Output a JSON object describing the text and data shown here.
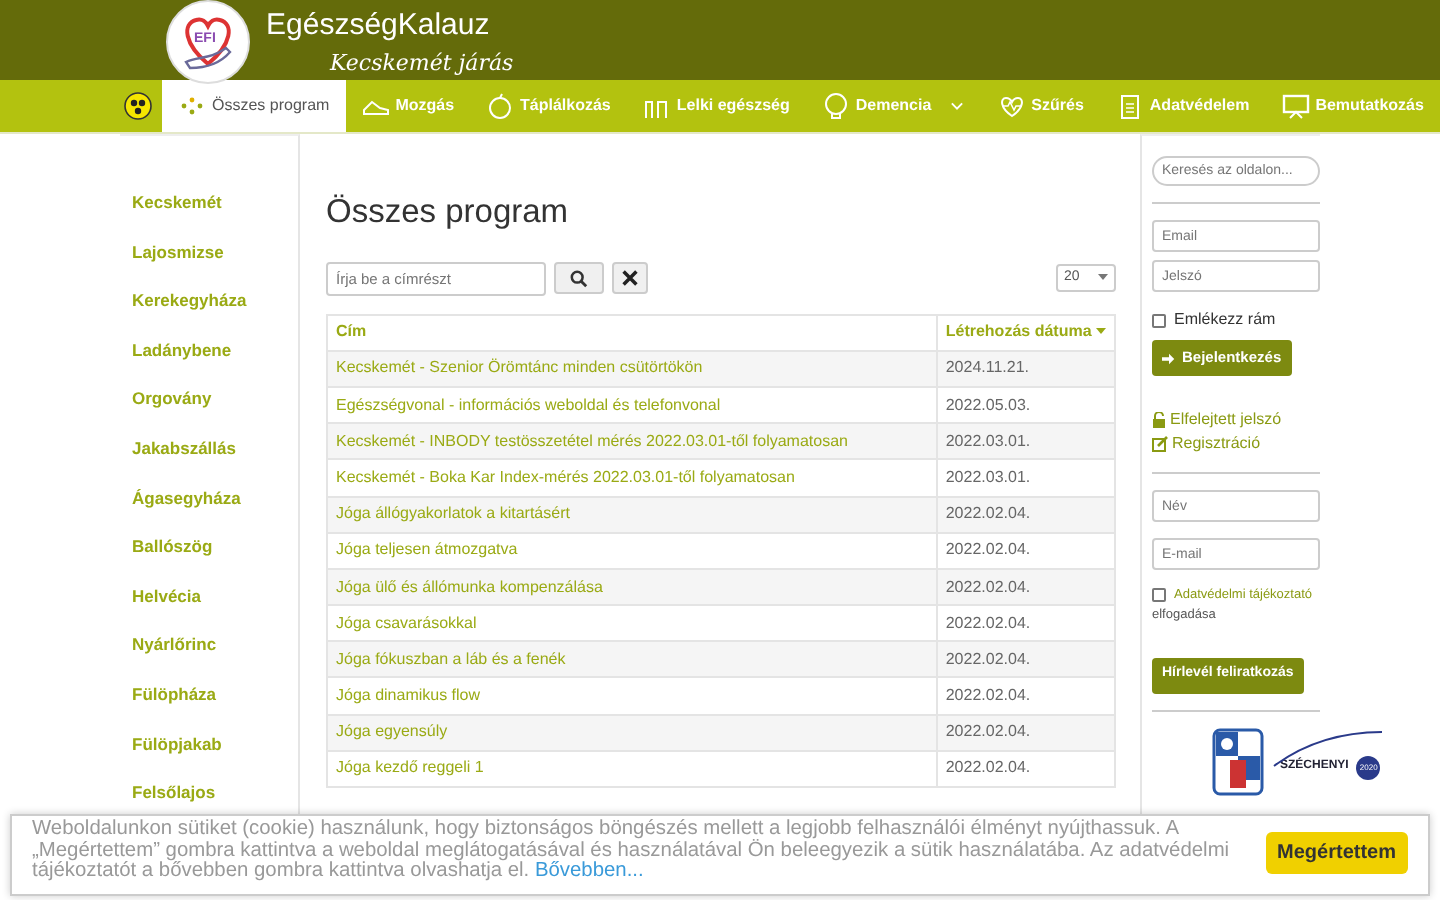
{
  "header": {
    "title": "EgészségKalauz",
    "subtitle": "Kecskemét járás",
    "logo_text": "EFI"
  },
  "nav": [
    {
      "label": "Összes program",
      "selected": true,
      "dropdown": false
    },
    {
      "label": "Mozgás",
      "selected": false,
      "dropdown": false
    },
    {
      "label": "Táplálkozás",
      "selected": false,
      "dropdown": false
    },
    {
      "label": "Lelki egészség",
      "selected": false,
      "dropdown": false
    },
    {
      "label": "Demencia",
      "selected": false,
      "dropdown": true
    },
    {
      "label": "Szűrés",
      "selected": false,
      "dropdown": false
    },
    {
      "label": "Adatvédelem",
      "selected": false,
      "dropdown": false
    },
    {
      "label": "Bemutatkozás",
      "selected": false,
      "dropdown": false
    }
  ],
  "sidebar": {
    "items": [
      "Kecskemét",
      "Lajosmizse",
      "Kerekegyháza",
      "Ladánybene",
      "Orgovány",
      "Jakabszállás",
      "Ágasegyháza",
      "Ballószög",
      "Helvécia",
      "Nyárlőrinc",
      "Fülöpháza",
      "Fülöpjakab",
      "Felsőlajos"
    ]
  },
  "main": {
    "heading": "Összes program",
    "filter": {
      "placeholder": "Írja be a címrészt"
    },
    "page_size": "20",
    "table": {
      "columns": [
        "Cím",
        "Létrehozás dátuma"
      ],
      "rows": [
        [
          "Kecskemét - Szenior Örömtánc minden csütörtökön",
          "2024.11.21."
        ],
        [
          "Egészségvonal - információs weboldal és telefonvonal",
          "2022.05.03."
        ],
        [
          "Kecskemét - INBODY testösszetétel mérés 2022.03.01-től folyamatosan",
          "2022.03.01."
        ],
        [
          "Kecskemét - Boka Kar Index-mérés 2022.03.01-től folyamatosan",
          "2022.03.01."
        ],
        [
          "Jóga állógyakorlatok a kitartásért",
          "2022.02.04."
        ],
        [
          "Jóga teljesen átmozgatva",
          "2022.02.04."
        ],
        [
          "Jóga ülő és állómunka kompenzálása",
          "2022.02.04."
        ],
        [
          "Jóga csavarásokkal",
          "2022.02.04."
        ],
        [
          "Jóga fókuszban a láb és a fenék",
          "2022.02.04."
        ],
        [
          "Jóga dinamikus flow",
          "2022.02.04."
        ],
        [
          "Jóga egyensúly",
          "2022.02.04."
        ],
        [
          "Jóga kezdő reggeli 1",
          "2022.02.04."
        ]
      ]
    }
  },
  "right": {
    "search": {
      "placeholder": "Keresés az oldalon..."
    },
    "login": {
      "email_placeholder": "Email",
      "password_placeholder": "Jelszó",
      "remember": {
        "label": "Emlékezz rám",
        "checked": false
      },
      "button": "Bejelentkezés",
      "forgot": "Elfelejtett jelszó",
      "register": "Regisztráció"
    },
    "newsletter": {
      "name_placeholder": "Név",
      "email_placeholder": "E-mail",
      "consent": {
        "link": "Adatvédelmi tájékoztató",
        "text": "elfogadása",
        "checked": false
      },
      "button": "Hírlevél feliratkozás"
    },
    "badge": {
      "text": "SZÉCHENYI",
      "year": "2020"
    }
  },
  "cookie": {
    "text": "Weboldalunkon sütiket (cookie) használunk, hogy biztonságos böngészés mellett a legjobb felhasználói élményt nyújthassuk. A „Megértettem” gombra kattintva a weboldal meglátogatásával és használatával Ön beleegyezik a sütik használatába. Az adatvédelmi tájékoztatót a bővebben gombra kattintva olvashatja el.",
    "link": "Bővebben...",
    "button": "Megértettem"
  }
}
